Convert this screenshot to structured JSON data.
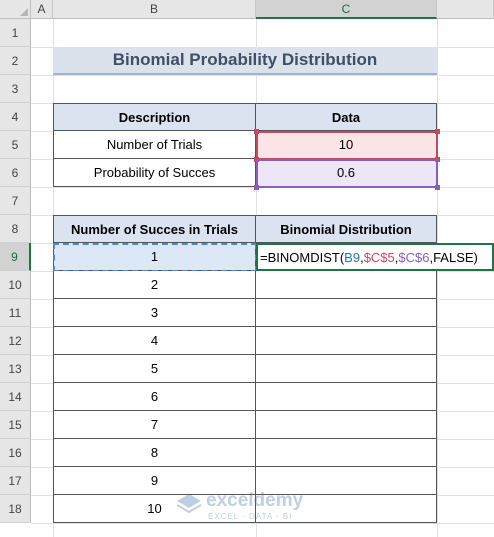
{
  "sheet": {
    "columns": [
      "A",
      "B",
      "C"
    ],
    "rows": [
      "1",
      "2",
      "3",
      "4",
      "5",
      "6",
      "7",
      "8",
      "9",
      "10",
      "11",
      "12",
      "13",
      "14",
      "15",
      "16",
      "17",
      "18"
    ]
  },
  "title": "Binomial Probability Distribution",
  "table1": {
    "headers": [
      "Description",
      "Data"
    ],
    "rows": [
      {
        "label": "Number of Trials",
        "value": "10"
      },
      {
        "label": "Probability of Succes",
        "value": "0.6"
      }
    ]
  },
  "table2": {
    "headers": [
      "Number of Succes in Trials",
      "Binomial Distribution"
    ],
    "values": [
      "1",
      "2",
      "3",
      "4",
      "5",
      "6",
      "7",
      "8",
      "9",
      "10"
    ]
  },
  "formula": {
    "prefix": "=BINOMDIST(",
    "arg1": "B9",
    "sep1": ",",
    "arg2": "$C$5",
    "sep2": ",",
    "arg3": "$C$6",
    "suffix": ",FALSE)"
  },
  "watermark": {
    "name": "exceldemy",
    "tagline": "EXCEL · DATA · BI"
  },
  "colors": {
    "accent": "#217346",
    "ref_b9": "#2d6fbd",
    "ref_c5": "#c04c5e",
    "ref_c6": "#8a5fb8"
  }
}
